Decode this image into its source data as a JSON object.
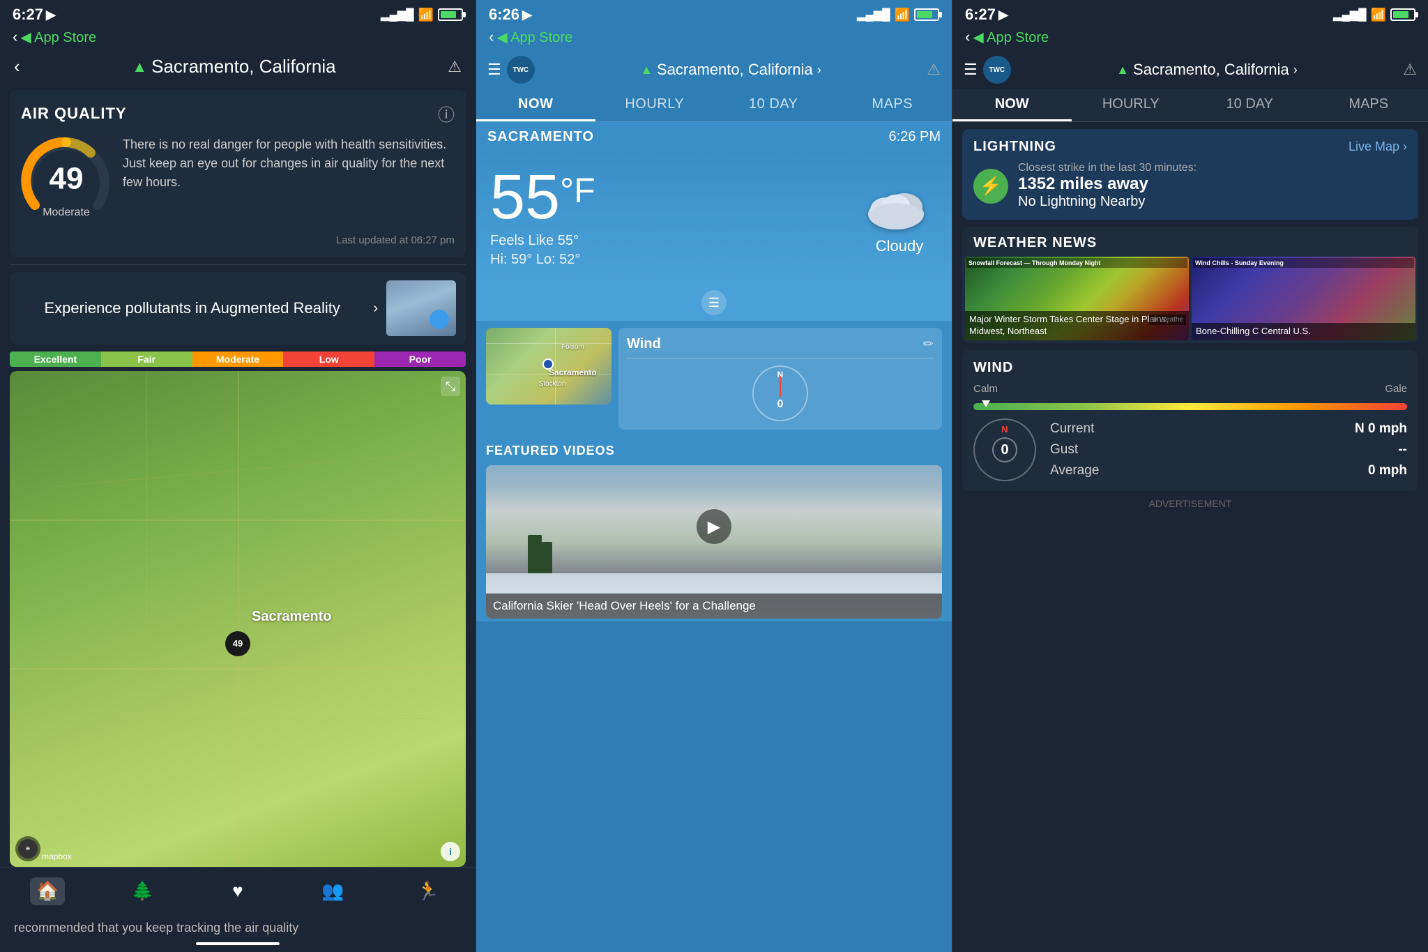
{
  "panel1": {
    "status": {
      "time": "6:27",
      "arrow": "▶",
      "signal_bars": "▂▄▆█",
      "wifi": "wifi",
      "battery_pct": 80
    },
    "app_store": "◀ App Store",
    "location": "Sacramento, California",
    "warning_icon": "⚠",
    "air_quality": {
      "title": "AIR QUALITY",
      "info_icon": "ⓘ",
      "aqi_value": "49",
      "aqi_label": "Moderate",
      "description": "There is no real danger for people with health sensitivities. Just keep an eye out for changes in air quality for the next few hours.",
      "last_updated": "Last updated at 06:27 pm"
    },
    "ar_banner": {
      "text": "Experience pollutants in Augmented Reality",
      "chevron": "›"
    },
    "aqi_scale": {
      "excellent": "Excellent",
      "fair": "Fair",
      "moderate": "Moderate",
      "low": "Low",
      "poor": "Poor"
    },
    "map": {
      "city_label": "Sacramento",
      "aqi_pin": "49",
      "mapbox_label": "mapbox",
      "info": "i"
    },
    "tab_bar": {
      "home": "🏠",
      "nature": "🌲",
      "health": "❤",
      "people": "👥",
      "run": "🏃"
    },
    "bottom_text": "recommended that you keep tracking the air quality"
  },
  "panel2": {
    "status": {
      "time": "6:26",
      "arrow": "▶"
    },
    "app_store": "◀ App Store",
    "nav": {
      "hamburger": "☰",
      "logo": "TWC",
      "location": "Sacramento, California",
      "chevron": "›",
      "warning": "⚠"
    },
    "tabs": [
      "NOW",
      "HOURLY",
      "10 DAY",
      "MAPS"
    ],
    "active_tab": "NOW",
    "location_bar": {
      "city": "SACRAMENTO",
      "time": "6:26 PM"
    },
    "weather": {
      "temperature": "55",
      "unit": "°F",
      "feels_like": "Feels Like 55°",
      "hi_lo": "Hi: 59°  Lo: 52°",
      "condition": "Cloudy"
    },
    "wind_card": {
      "title": "Wind",
      "compass_value": "0"
    },
    "featured_videos": {
      "title": "FEATURED VIDEOS",
      "video_caption": "California Skier 'Head Over Heels' for a Challenge"
    }
  },
  "panel3": {
    "status": {
      "time": "6:27",
      "arrow": "▶"
    },
    "app_store": "◀ App Store",
    "nav": {
      "hamburger": "☰",
      "logo": "TWC",
      "location": "Sacramento, California",
      "chevron": "›",
      "warning": "⚠"
    },
    "tabs": [
      "NOW",
      "HOURLY",
      "10 DAY",
      "MAPS"
    ],
    "active_tab": "NOW",
    "lightning": {
      "title": "LIGHTNING",
      "live_map": "Live Map ›",
      "subtitle": "Closest strike in the last 30 minutes:",
      "distance": "1352 miles away",
      "status": "No Lightning Nearby",
      "icon": "⚡"
    },
    "weather_news": {
      "title": "WEATHER NEWS",
      "story1_caption": "Major Winter Storm Takes Center Stage in Plains, Midwest, Northeast",
      "story2_caption": "Bone-Chilling C Central U.S.",
      "logo": "⊕ Weathe"
    },
    "wind": {
      "title": "WIND",
      "calm_label": "Calm",
      "gale_label": "Gale",
      "compass_value": "0",
      "current_label": "Current",
      "current_value": "N  0 mph",
      "gust_label": "Gust",
      "gust_value": "--",
      "average_label": "Average",
      "average_value": "0  mph"
    },
    "ad_label": "ADVERTISEMENT"
  }
}
